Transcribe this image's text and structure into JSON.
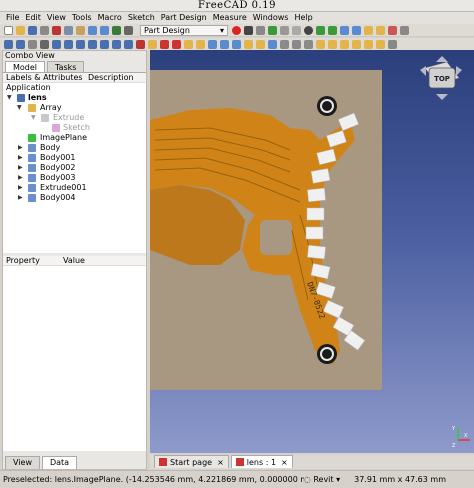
{
  "window": {
    "title": "FreeCAD 0.19"
  },
  "menu": [
    "File",
    "Edit",
    "View",
    "Tools",
    "Macro",
    "Sketch",
    "Part Design",
    "Measure",
    "Windows",
    "Help"
  ],
  "toolbar": {
    "workbench": "Part Design"
  },
  "combo": {
    "title": "Combo View",
    "tabs": [
      "Model",
      "Tasks"
    ],
    "tree_headers": [
      "Labels & Attributes",
      "Description"
    ],
    "root": "Application",
    "items": [
      {
        "label": "lens",
        "bold": true
      },
      {
        "label": "Array"
      },
      {
        "label": "Extrude",
        "greyed": true
      },
      {
        "label": "Sketch",
        "greyed": true
      },
      {
        "label": "ImagePlane"
      },
      {
        "label": "Body"
      },
      {
        "label": "Body001"
      },
      {
        "label": "Body002"
      },
      {
        "label": "Body003"
      },
      {
        "label": "Extrude001"
      },
      {
        "label": "Body004"
      }
    ],
    "prop_headers": [
      "Property",
      "Value"
    ],
    "bottom_tabs": [
      "View",
      "Data"
    ]
  },
  "viewport": {
    "navcube_label": "TOP",
    "part_marking": "DN7-0522",
    "board_color": "#d4820f",
    "pad_color": "#f0f0f0",
    "background_color": "#2b3f7c",
    "axes": [
      "X",
      "Y",
      "Z"
    ]
  },
  "doc_tabs": [
    {
      "label": "Start page",
      "close": "×"
    },
    {
      "label": "lens : 1",
      "close": "×"
    }
  ],
  "status": {
    "message": "Preselected: lens.ImagePlane. (-14.253546 mm, 4.221869 mm, 0.000000 mm)",
    "navstyle": "Revit",
    "dimensions": "37.91 mm x 47.63 mm"
  }
}
